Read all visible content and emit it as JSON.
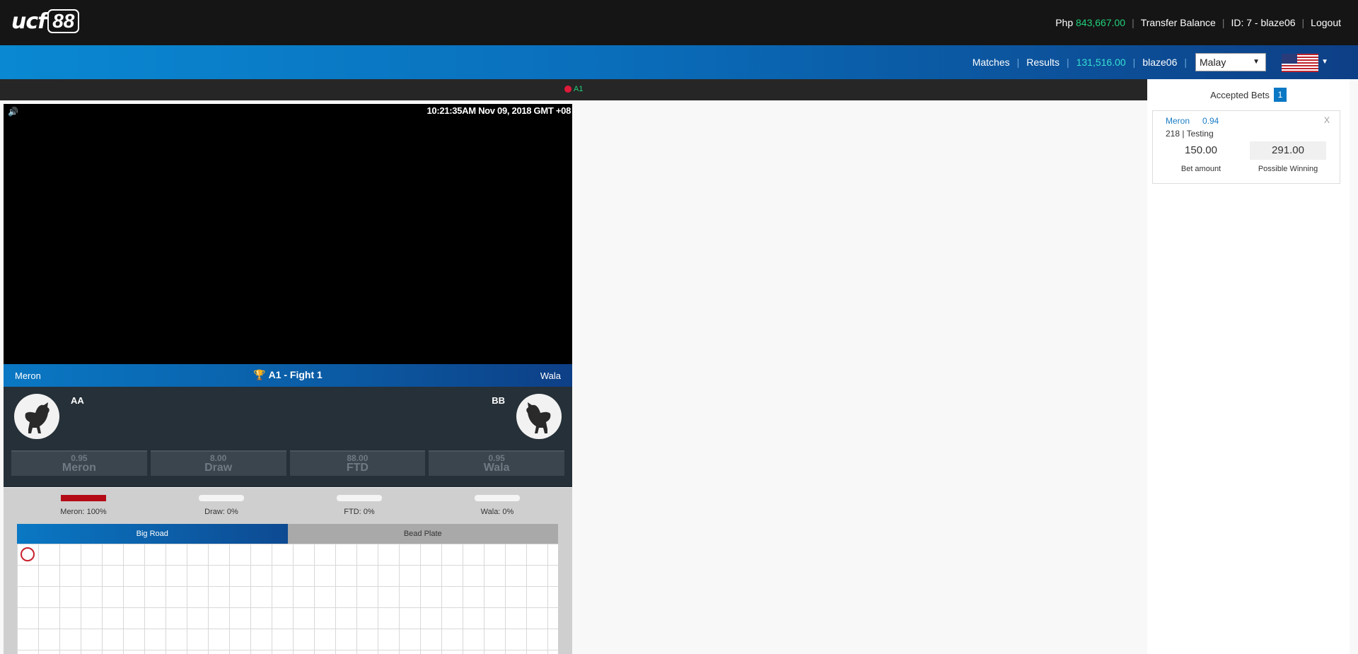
{
  "header": {
    "logo_text": "ucf",
    "logo_number": "88",
    "currency": "Php",
    "balance": "843,667.00",
    "transfer_label": "Transfer Balance",
    "account_id": "ID: 7 - blaze06",
    "logout_label": "Logout"
  },
  "nav": {
    "matches_label": "Matches",
    "results_label": "Results",
    "credit": "131,516.00",
    "username": "blaze06",
    "language_selected": "Malay",
    "flag_icon": "us-flag-icon"
  },
  "arena": {
    "label": "A1"
  },
  "video": {
    "timestamp": "10:21:35AM Nov 09, 2018 GMT +08"
  },
  "fight": {
    "left_side": "Meron",
    "right_side": "Wala",
    "title": "A1 - Fight 1",
    "left_name": "AA",
    "right_name": "BB",
    "odds": [
      {
        "value": "0.95",
        "label": "Meron"
      },
      {
        "value": "8.00",
        "label": "Draw"
      },
      {
        "value": "88.00",
        "label": "FTD"
      },
      {
        "value": "0.95",
        "label": "Wala"
      }
    ]
  },
  "stats": {
    "items": [
      {
        "label": "Meron: 100%",
        "percent": 100
      },
      {
        "label": "Draw: 0%",
        "percent": 0
      },
      {
        "label": "FTD: 0%",
        "percent": 0
      },
      {
        "label": "Wala: 0%",
        "percent": 0
      }
    ],
    "tab_big_road": "Big Road",
    "tab_bead_plate": "Bead Plate"
  },
  "bets": {
    "title": "Accepted Bets",
    "count": "1",
    "items": [
      {
        "side": "Meron",
        "odds": "0.94",
        "close": "X",
        "ref": "218 | Testing",
        "amount": "150.00",
        "amount_label": "Bet amount",
        "winning": "291.00",
        "winning_label": "Possible Winning"
      }
    ]
  },
  "colors": {
    "topbar": "#151515",
    "accent_blue": "#0a78c4",
    "balance_green": "#1fd07a",
    "meron_red": "#b40b17"
  }
}
